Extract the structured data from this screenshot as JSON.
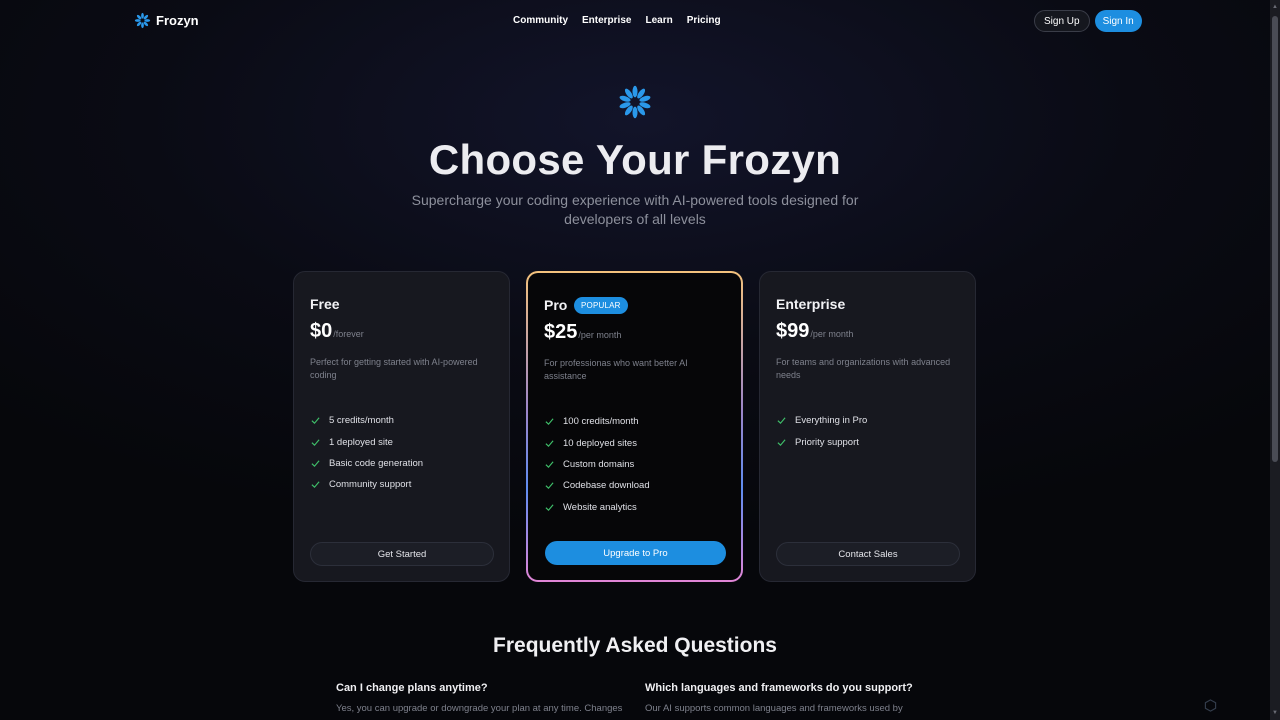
{
  "brand": {
    "name": "Frozyn",
    "logo_icon": "snowflake-icon",
    "accent": "#1d8ee0"
  },
  "nav": {
    "items": [
      "Community",
      "Enterprise",
      "Learn",
      "Pricing"
    ]
  },
  "auth": {
    "sign_up": "Sign Up",
    "sign_in": "Sign In"
  },
  "hero": {
    "title": "Choose Your Frozyn",
    "subtitle": "Supercharge your coding experience with AI-powered tools designed for developers of all levels"
  },
  "plans": [
    {
      "name": "Free",
      "price": "$0",
      "period": "/forever",
      "description": "Perfect for getting started with AI-powered coding",
      "features": [
        "5 credits/month",
        "1 deployed site",
        "Basic code generation",
        "Community support"
      ],
      "cta": "Get Started"
    },
    {
      "name": "Pro",
      "badge": "POPULAR",
      "price": "$25",
      "period": "/per month",
      "description": "For professionas who want better AI assistance",
      "features": [
        "100 credits/month",
        "10 deployed sites",
        "Custom domains",
        "Codebase download",
        "Website analytics"
      ],
      "cta": "Upgrade to Pro"
    },
    {
      "name": "Enterprise",
      "price": "$99",
      "period": "/per month",
      "description": "For teams and organizations with advanced needs",
      "features": [
        "Everything in Pro",
        "Priority support"
      ],
      "cta": "Contact Sales"
    }
  ],
  "faq": {
    "title": "Frequently Asked Questions",
    "items": [
      {
        "question": "Can I change plans anytime?",
        "answer": "Yes, you can upgrade or downgrade your plan at any time. Changes"
      },
      {
        "question": "Which languages and frameworks do you support?",
        "answer": "Our AI supports common languages and frameworks used by"
      }
    ]
  },
  "colors": {
    "check": "#3fbf6a",
    "background": "#06070b",
    "card": "#17181f"
  }
}
